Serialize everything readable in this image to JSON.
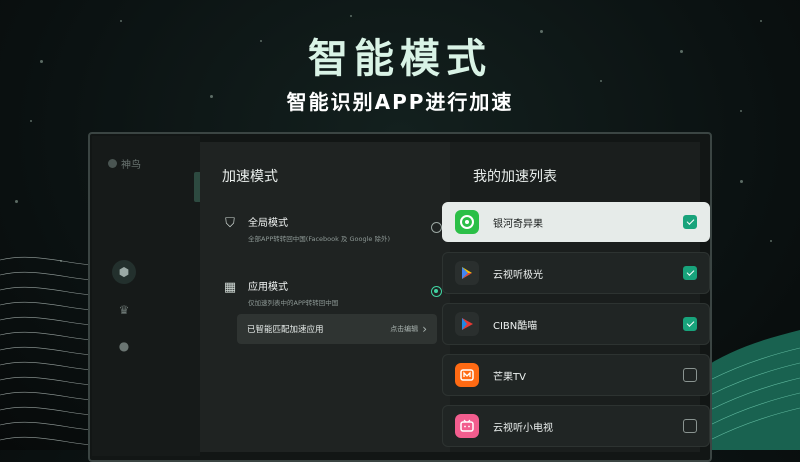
{
  "headline": "智能模式",
  "subheadline": "智能识别APP进行加速",
  "sidebar": {
    "brand": "神鸟",
    "nav_icons": [
      "speed-icon",
      "crown-icon",
      "user-icon"
    ]
  },
  "accel_modes": {
    "title": "加速模式",
    "modes": [
      {
        "name": "全局模式",
        "desc": "全部APP转转回中国(Facebook 及 Google 除外)",
        "selected": false,
        "icon": "shield-icon"
      },
      {
        "name": "应用模式",
        "desc": "仅加速列表中的APP转转回中国",
        "selected": true,
        "icon": "grid-icon"
      }
    ],
    "matched_label": "已智能匹配加速应用",
    "edit_action": "点击编辑"
  },
  "app_list": {
    "title": "我的加速列表",
    "apps": [
      {
        "name": "银河奇异果",
        "checked": true,
        "focused": true,
        "logo_color": "#2bbf47",
        "icon": "kiwi-icon"
      },
      {
        "name": "云视听极光",
        "checked": true,
        "focused": false,
        "logo_color": "#2a2f2e",
        "icon": "play-store-icon"
      },
      {
        "name": "CIBN酷喵",
        "checked": true,
        "focused": false,
        "logo_color": "#2a2f2e",
        "icon": "cibn-icon"
      },
      {
        "name": "芒果TV",
        "checked": false,
        "focused": false,
        "logo_color": "#ff6a13",
        "icon": "mango-icon"
      },
      {
        "name": "云视听小电视",
        "checked": false,
        "focused": false,
        "logo_color": "#f25d8e",
        "icon": "bilibili-icon"
      }
    ]
  },
  "colors": {
    "accent": "#41d3a2",
    "check_on": "#18a37b"
  }
}
